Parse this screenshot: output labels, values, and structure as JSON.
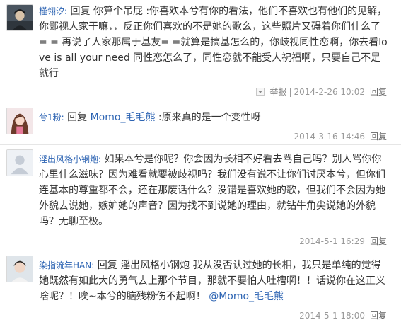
{
  "comments": [
    {
      "user": "槿翎汐:",
      "prefix": "回复 你算个吊屁 :",
      "body": "你喜欢本兮有你的看法，他们不喜欢也有他们的见解，你鄙视人家干嘛，，反正你们喜欢的不是她的歌么，这些照片又碍着你们什么了= = 再说了人家那属于基友= =就算是搞基怎么的，你歧视同性恋啊，你去看love is all your need 同性恋怎么了，同性恋就不能受人祝福啊，只要自己不是就行",
      "report": "举报",
      "time": "2014-2-26 10:02",
      "reply": "回复"
    },
    {
      "user": "兮1粉:",
      "prefix": "回复 ",
      "mention": "Momo_毛毛熊",
      "body": " :原来真的是一个变性呀",
      "time": "2014-3-16 14:46",
      "reply": "回复"
    },
    {
      "user": "淫出风格小钢炮:",
      "body": "如果本兮是你呢？你会因为长相不好看去骂自己吗？别人骂你你心里什么滋味？因为难看就要被歧视吗？我们没有说不让你们讨厌本兮，但你们连基本的尊重都不会，还在那废话什么？没错是喜欢她的歌，但我们不会因为她外貌去说她，嫉妒她的声音？因为找不到说她的理由，就钻牛角尖说她的外貌吗？无聊至极。",
      "time": "2014-5-1 16:29",
      "reply": "回复"
    },
    {
      "user": "染指流年HAN:",
      "body": "回复 淫出风格小钢炮 我从没否认过她的长相，我只是单纯的觉得她既然有如此大的勇气去上那个节目，那就不要怕人吐槽啊！！话说你在这正义啥呢？！唉~本兮的脑残粉伤不起啊！",
      "mention": "@Momo_毛毛熊",
      "time": "2014-5-1 18:00",
      "reply": "回复"
    }
  ]
}
